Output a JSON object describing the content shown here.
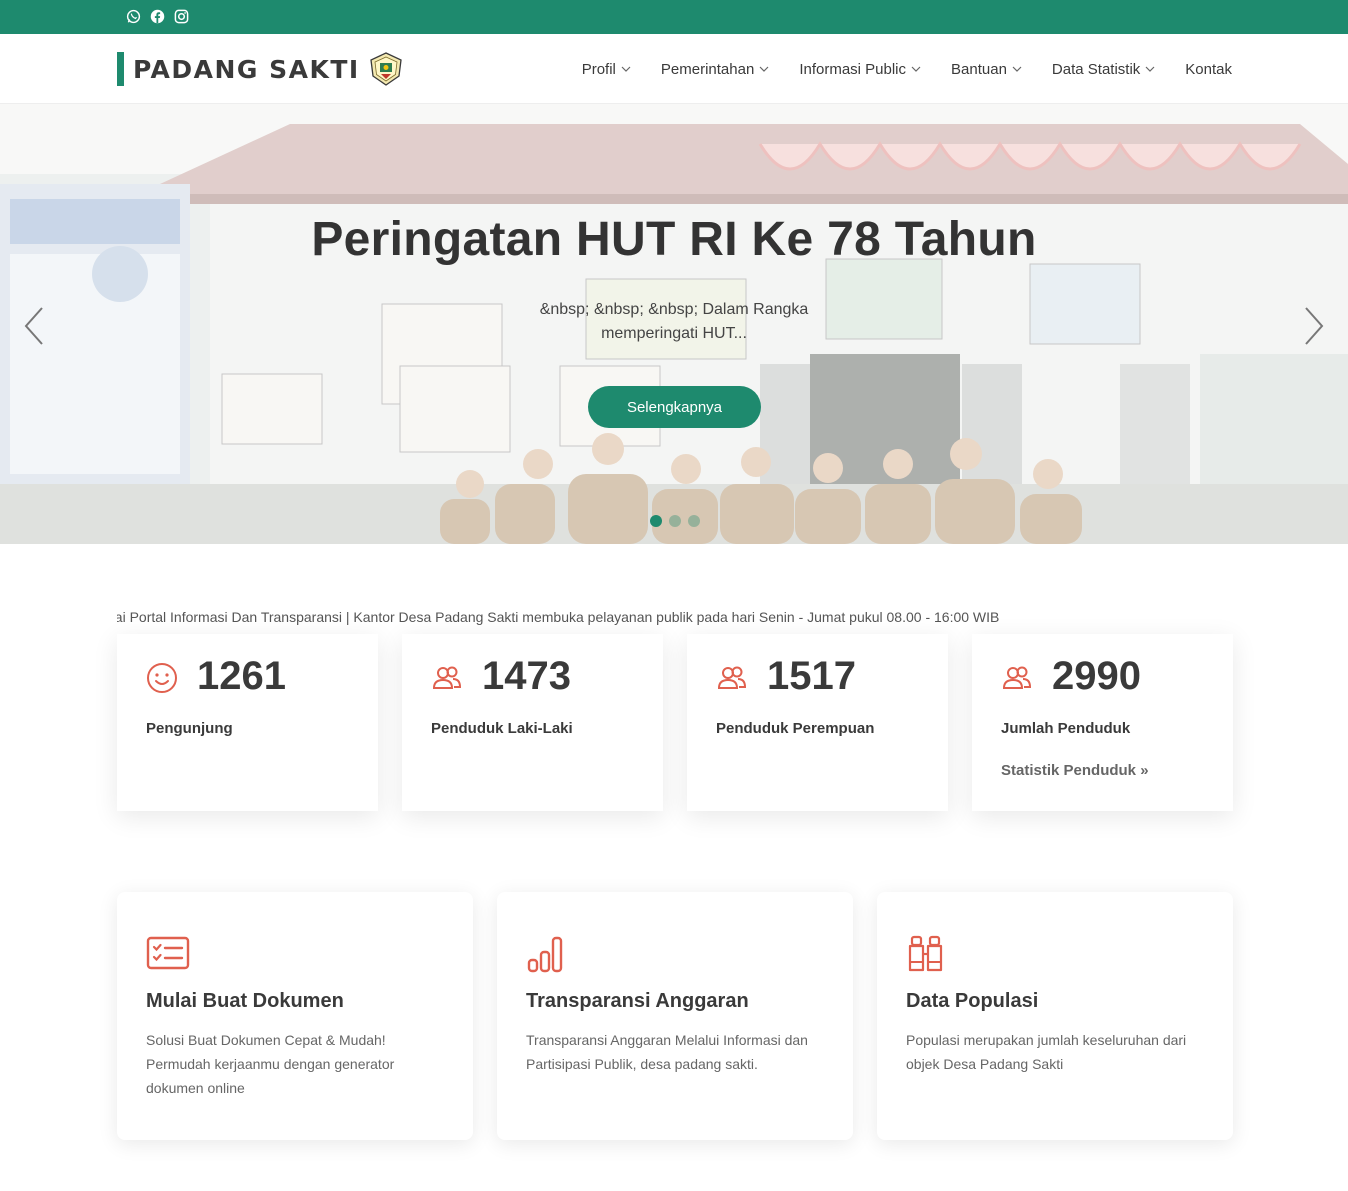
{
  "topbar": {
    "social_icons": [
      "whatsapp-icon",
      "facebook-icon",
      "instagram-icon"
    ],
    "color": "#1e8a6e"
  },
  "brand": {
    "name": "PADANG SAKTI",
    "accent": "#1e8a6e"
  },
  "nav": {
    "items": [
      {
        "label": "Profil",
        "dropdown": true
      },
      {
        "label": "Pemerintahan",
        "dropdown": true
      },
      {
        "label": "Informasi Public",
        "dropdown": true
      },
      {
        "label": "Bantuan",
        "dropdown": true
      },
      {
        "label": "Data Statistik",
        "dropdown": true
      },
      {
        "label": "Kontak",
        "dropdown": false
      }
    ]
  },
  "hero": {
    "title": "Peringatan HUT RI Ke 78 Tahun",
    "excerpt": "&nbsp; &nbsp; &nbsp; Dalam Rangka memperingati HUT...",
    "cta_label": "Selengkapnya",
    "slide_count": 3,
    "active_slide": 1
  },
  "ticker": {
    "text": "gai Portal Informasi Dan Transparansi | Kantor Desa Padang Sakti membuka pelayanan publik pada hari Senin - Jumat pukul 08.00 - 16:00 WIB"
  },
  "stats": [
    {
      "icon": "smile-icon",
      "value": "1261",
      "label": "Pengunjung"
    },
    {
      "icon": "users-icon",
      "value": "1473",
      "label": "Penduduk Laki-Laki"
    },
    {
      "icon": "users-icon",
      "value": "1517",
      "label": "Penduduk Perempuan"
    },
    {
      "icon": "users-icon",
      "value": "2990",
      "label": "Jumlah Penduduk",
      "link": "Statistik Penduduk »"
    }
  ],
  "features": [
    {
      "icon": "checklist-icon",
      "title": "Mulai Buat Dokumen",
      "text": "Solusi Buat Dokumen Cepat & Mudah! Permudah kerjaanmu dengan generator dokumen online"
    },
    {
      "icon": "bar-chart-icon",
      "title": "Transparansi Anggaran",
      "text": "Transparansi Anggaran Melalui Informasi dan Partisipasi Publik, desa padang sakti."
    },
    {
      "icon": "binoculars-icon",
      "title": "Data Populasi",
      "text": "Populasi merupakan jumlah keseluruhan dari objek Desa Padang Sakti"
    }
  ],
  "colors": {
    "primary": "#1e8a6e",
    "icon_accent": "#e0604e"
  }
}
